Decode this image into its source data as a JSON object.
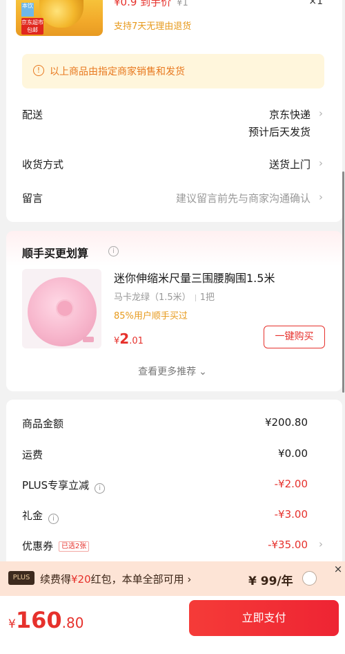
{
  "product": {
    "price": "¥0.9 到手价",
    "unit_price": "¥1",
    "quantity": "×1",
    "return_policy": "支持7天无理由退货",
    "thumb_tag": "本饮",
    "thumb_badge": "京东超市 包邮"
  },
  "notice": {
    "icon": "info-icon",
    "text": "以上商品由指定商家销售和发货"
  },
  "delivery": {
    "label": "配送",
    "carrier": "京东快递",
    "eta": "预计后天发货"
  },
  "receive": {
    "label": "收货方式",
    "value": "送货上门"
  },
  "message": {
    "label": "留言",
    "placeholder": "建议留言前先与商家沟通确认"
  },
  "recommend": {
    "title": "顺手买更划算",
    "item_name": "迷你伸缩米尺量三围腰胸围1.5米",
    "item_color": "马卡龙绿（1.5米）",
    "item_qty": "1把",
    "users_text": "85%用户顺手买过",
    "price_symbol": "¥",
    "price_int": "2",
    "price_dec": ".01",
    "buy_label": "一键购买",
    "more_label": "查看更多推荐"
  },
  "summary": {
    "goods_label": "商品金额",
    "goods_value": "¥200.80",
    "shipping_label": "运费",
    "shipping_value": "¥0.00",
    "plus_label": "PLUS专享立减",
    "plus_value": "-¥2.00",
    "gift_label": "礼金",
    "gift_value": "-¥3.00",
    "coupon_label": "优惠券",
    "coupon_tag": "已选2张",
    "coupon_value": "-¥35.00"
  },
  "plus_banner": {
    "logo": "PLUS",
    "text_before": "续费得",
    "text_highlight": "¥20",
    "text_after": "红包，本单全部可用 ›",
    "price": "¥ 99/年",
    "close": "×"
  },
  "bottom": {
    "total_symbol": "¥",
    "total_int": "160",
    "total_dec": ".80",
    "pay_label": "立即支付"
  },
  "colors": {
    "accent_red": "#e6312c",
    "orange": "#e79a1c",
    "notice_bg": "#fff6dc",
    "plus_bg": "#fde4d6"
  }
}
